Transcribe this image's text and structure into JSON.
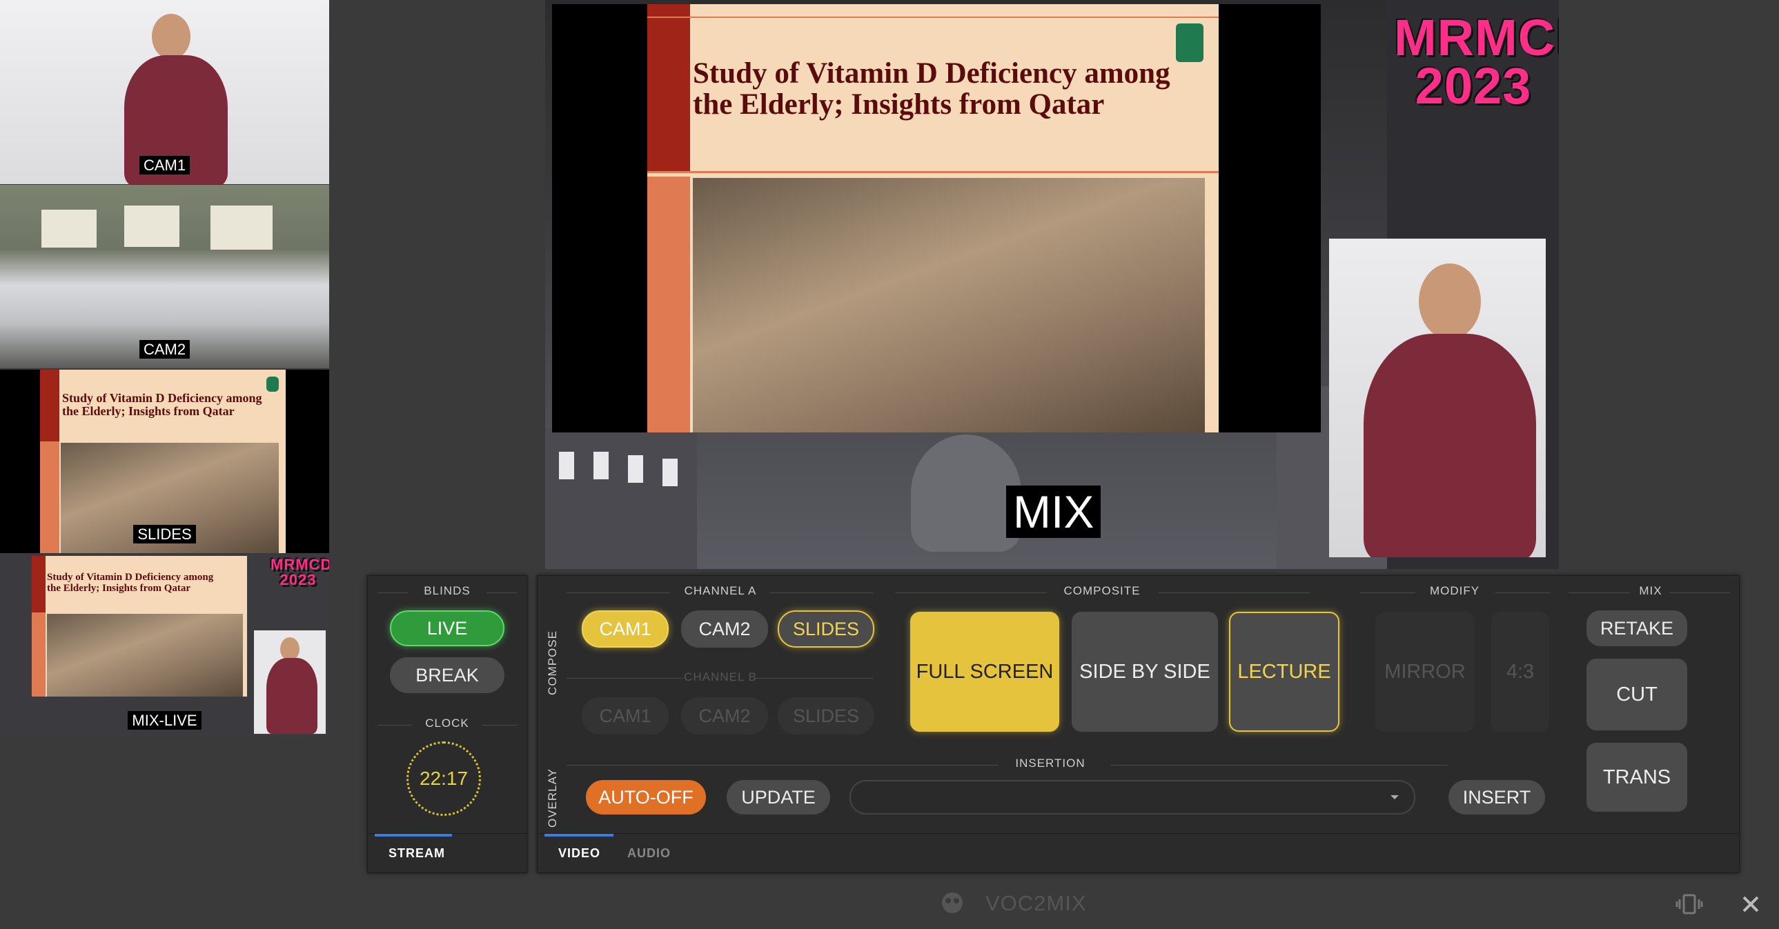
{
  "previews": [
    {
      "label": "CAM1"
    },
    {
      "label": "CAM2"
    },
    {
      "label": "SLIDES"
    },
    {
      "label": "MIX-LIVE"
    }
  ],
  "slide": {
    "title_line1": "Study of Vitamin D Deficiency among",
    "title_line2": "the Elderly; Insights from Qatar"
  },
  "mix": {
    "label": "MIX",
    "event_line1": "MRMCD",
    "event_line2": "2023"
  },
  "blinds_panel": {
    "blinds_title": "BLINDS",
    "live_label": "LIVE",
    "break_label": "BREAK",
    "clock_title": "CLOCK",
    "clock_time": "22:17",
    "tab_stream": "STREAM"
  },
  "main_panel": {
    "compose_label": "COMPOSE",
    "overlay_label": "OVERLAY",
    "channel_a_title": "CHANNEL A",
    "channel_b_title": "CHANNEL B",
    "composite_title": "COMPOSITE",
    "modify_title": "MODIFY",
    "mix_title": "MIX",
    "channel_a": [
      "CAM1",
      "CAM2",
      "SLIDES"
    ],
    "channel_b": [
      "CAM1",
      "CAM2",
      "SLIDES"
    ],
    "composite": [
      "FULL SCREEN",
      "SIDE BY SIDE",
      "LECTURE"
    ],
    "modify": [
      "MIRROR",
      "4:3"
    ],
    "mix_buttons": [
      "RETAKE",
      "CUT",
      "TRANS"
    ],
    "insertion_title": "INSERTION",
    "auto_off_label": "AUTO-OFF",
    "update_label": "UPDATE",
    "insert_label": "INSERT",
    "insertion_value": "",
    "tab_video": "VIDEO",
    "tab_audio": "AUDIO"
  },
  "footer": {
    "app_name": "VOC2MIX"
  },
  "colors": {
    "accent_yellow": "#e6c33c",
    "live_green": "#2f9b3b",
    "auto_off_orange": "#e07026",
    "tab_indicator": "#3d7be0",
    "mrmcd_pink": "#ff2e88"
  },
  "icons": [
    "voc-logo-icon",
    "vibrate-icon",
    "close-icon",
    "dropdown-arrow-icon"
  ]
}
